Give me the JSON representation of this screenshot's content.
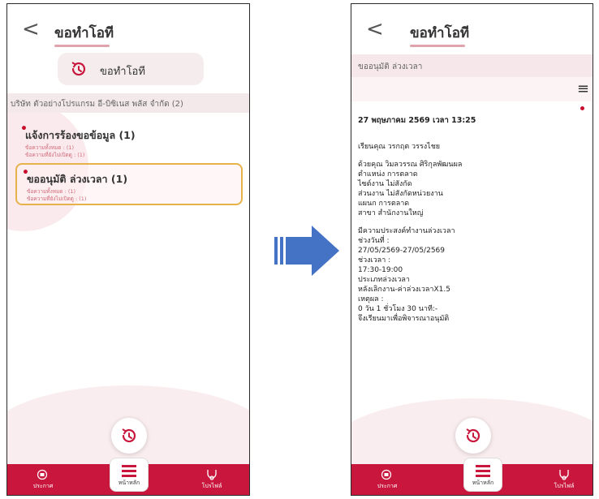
{
  "left": {
    "header": {
      "title": "ขอทำโอที"
    },
    "chip": {
      "label": "ขอทำโอที"
    },
    "company": "บริษัท ตัวอย่างโปรแกรม อี-บิซิเนส พลัส จำกัด  (2)",
    "items": [
      {
        "title": "แจ้งการร้องขอข้อมูล (1)",
        "total": "ข้อความทั้งหมด : (1)",
        "unread": "ข้อความที่ยังไม่เปิดดู : (1)"
      },
      {
        "title": "ขออนุมัติ ล่วงเวลา (1)",
        "total": "ข้อความทั้งหมด : (1)",
        "unread": "ข้อความที่ยังไม่เปิดดู : (1)"
      }
    ]
  },
  "right": {
    "header": {
      "title": "ขอทำโอที"
    },
    "subtitle": "ขออนุมัติ ล่วงเวลา",
    "date": "27 พฤษภาคม 2569 เวลา 13:25",
    "greeting": "เรียนคุณ วรกฤต วรรงไชย",
    "requester": [
      "ด้วยคุณ วิมลวรรณ ศิริกุลพัฒนผล",
      "ตำแหน่ง การตลาด",
      "ไซต์งาน ไม่สังกัด",
      "ส่วนงาน ไม่สังกัดหน่วยงาน",
      "แผนก การตลาด",
      "สาขา สำนักงานใหญ่"
    ],
    "details": [
      "มีความประสงค์ทำงานล่วงเวลา",
      "ช่วงวันที่ :",
      "27/05/2569-27/05/2569",
      "ช่วงเวลา :",
      "17:30-19:00",
      "ประเภทล่วงเวลา",
      "หลังเลิกงาน-ค่าล่วงเวลาX1.5",
      "เหตุผล :",
      "0 วัน 1 ชั่วโมง 30 นาที:-",
      "จึงเรียนมาเพื่อพิจารณาอนุมัติ"
    ]
  },
  "nav": {
    "news": "ประกาศ",
    "home": "หน้าหลัก",
    "profile": "โปรไฟล์"
  },
  "icons": {
    "back": "chevron-left-icon",
    "ot": "ot-request-icon",
    "menu": "hamburger-icon",
    "news": "megaphone-icon",
    "home": "home-menu-icon",
    "profile": "profile-icon",
    "arrow": "right-arrow-icon"
  },
  "colors": {
    "accent": "#c8163c",
    "highlight": "#e6b24a",
    "arrow": "#4472c4"
  }
}
